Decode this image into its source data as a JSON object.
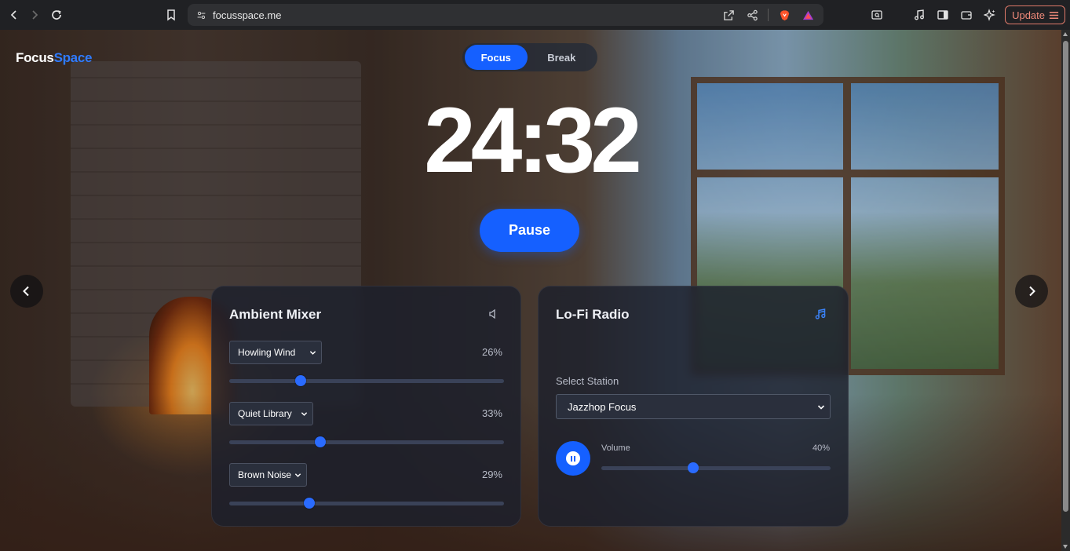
{
  "browser": {
    "url": "focusspace.me",
    "update_label": "Update"
  },
  "app": {
    "logo_part1": "Focus",
    "logo_part2": "Space",
    "accent_color": "#1560ff"
  },
  "mode_toggle": {
    "focus_label": "Focus",
    "break_label": "Break",
    "active": "Focus"
  },
  "timer": {
    "display": "24:32"
  },
  "controls": {
    "pause_label": "Pause"
  },
  "mixer": {
    "title": "Ambient Mixer",
    "icon": "speaker-icon",
    "channels": [
      {
        "sound": "Howling Wind",
        "value": 26,
        "value_label": "26%"
      },
      {
        "sound": "Quiet Library",
        "value": 33,
        "value_label": "33%"
      },
      {
        "sound": "Brown Noise",
        "value": 29,
        "value_label": "29%"
      }
    ]
  },
  "radio": {
    "title": "Lo-Fi Radio",
    "icon": "music-note-icon",
    "station_label": "Select Station",
    "station_value": "Jazzhop Focus",
    "volume_label": "Volume",
    "volume": 40,
    "volume_label_pct": "40%"
  }
}
